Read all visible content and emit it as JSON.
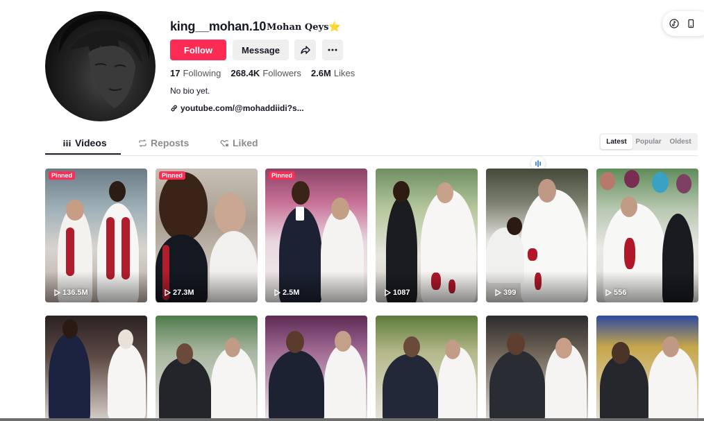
{
  "profile": {
    "username": "king__mohan.10",
    "nickname": "Mohan Qeys",
    "nickname_badge": "⭐",
    "follow_label": "Follow",
    "message_label": "Message",
    "following_count": "17",
    "following_label": "Following",
    "followers_count": "268.4K",
    "followers_label": "Followers",
    "likes_count": "2.6M",
    "likes_label": "Likes",
    "bio": "No bio yet.",
    "link": "youtube.com/@mohaddiidi?s..."
  },
  "tabs": [
    {
      "label": "Videos",
      "icon": "grid-icon",
      "active": true
    },
    {
      "label": "Reposts",
      "icon": "repost-icon",
      "active": false
    },
    {
      "label": "Liked",
      "icon": "heart-lock-icon",
      "active": false
    }
  ],
  "sort": [
    "Latest",
    "Popular",
    "Oldest"
  ],
  "pinned_label": "Pinned",
  "videos": [
    {
      "views": "136.5M",
      "pinned": true
    },
    {
      "views": "27.3M",
      "pinned": true
    },
    {
      "views": "2.5M",
      "pinned": true
    },
    {
      "views": "1087",
      "pinned": false
    },
    {
      "views": "399",
      "pinned": false
    },
    {
      "views": "556",
      "pinned": false
    }
  ],
  "colors": {
    "accent": "#fe2c55"
  }
}
